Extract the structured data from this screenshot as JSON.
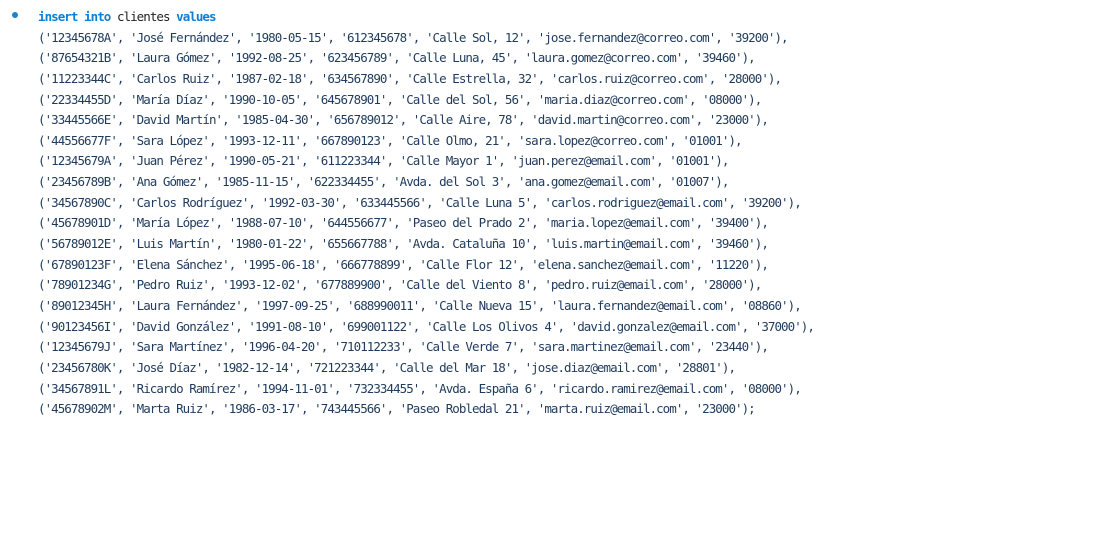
{
  "statement": {
    "keyword_insert": "insert",
    "keyword_into": "into",
    "table_name": "clientes",
    "keyword_values": "values"
  },
  "rows": [
    "('12345678A', 'José Fernández', '1980-05-15', '612345678', 'Calle Sol, 12', 'jose.fernandez@correo.com', '39200'),",
    "('87654321B', 'Laura Gómez', '1992-08-25', '623456789', 'Calle Luna, 45', 'laura.gomez@correo.com', '39460'),",
    "('11223344C', 'Carlos Ruiz', '1987-02-18', '634567890', 'Calle Estrella, 32', 'carlos.ruiz@correo.com', '28000'),",
    "('22334455D', 'María Díaz', '1990-10-05', '645678901', 'Calle del Sol, 56', 'maria.diaz@correo.com', '08000'),",
    "('33445566E', 'David Martín', '1985-04-30', '656789012', 'Calle Aire, 78', 'david.martin@correo.com', '23000'),",
    "('44556677F', 'Sara López', '1993-12-11', '667890123', 'Calle Olmo, 21', 'sara.lopez@correo.com', '01001'),",
    "('12345679A', 'Juan Pérez', '1990-05-21', '611223344', 'Calle Mayor 1', 'juan.perez@email.com', '01001'),",
    "('23456789B', 'Ana Gómez', '1985-11-15', '622334455', 'Avda. del Sol 3', 'ana.gomez@email.com', '01007'),",
    "('34567890C', 'Carlos Rodríguez', '1992-03-30', '633445566', 'Calle Luna 5', 'carlos.rodriguez@email.com', '39200'),",
    "('45678901D', 'María López', '1988-07-10', '644556677', 'Paseo del Prado 2', 'maria.lopez@email.com', '39400'),",
    "('56789012E', 'Luis Martín', '1980-01-22', '655667788', 'Avda. Cataluña 10', 'luis.martin@email.com', '39460'),",
    "('67890123F', 'Elena Sánchez', '1995-06-18', '666778899', 'Calle Flor 12', 'elena.sanchez@email.com', '11220'),",
    "('78901234G', 'Pedro Ruiz', '1993-12-02', '677889900', 'Calle del Viento 8', 'pedro.ruiz@email.com', '28000'),",
    "('89012345H', 'Laura Fernández', '1997-09-25', '688990011', 'Calle Nueva 15', 'laura.fernandez@email.com', '08860'),",
    "('90123456I', 'David González', '1991-08-10', '699001122', 'Calle Los Olivos 4', 'david.gonzalez@email.com', '37000'),",
    "('12345679J', 'Sara Martínez', '1996-04-20', '710112233', 'Calle Verde 7', 'sara.martinez@email.com', '23440'),",
    "('23456780K', 'José Díaz', '1982-12-14', '721223344', 'Calle del Mar 18', 'jose.diaz@email.com', '28801'),",
    "('34567891L', 'Ricardo Ramírez', '1994-11-01', '732334455', 'Avda. España 6', 'ricardo.ramirez@email.com', '08000'),",
    "('45678902M', 'Marta Ruiz', '1986-03-17', '743445566', 'Paseo Robledal 21', 'marta.ruiz@email.com', '23000');"
  ],
  "colors": {
    "keyword": "#0b7fd6",
    "bullet": "#1a85c8",
    "text": "#1f1f1f",
    "values_text": "#1f3b5c"
  },
  "icons": {
    "bullet": "bullet-dot-icon"
  }
}
